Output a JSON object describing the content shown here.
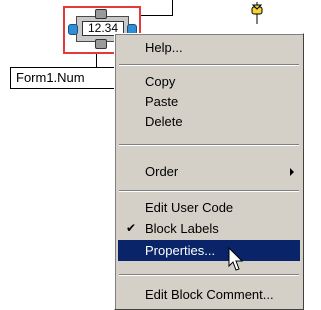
{
  "block": {
    "value": "12.34"
  },
  "form_label": "Form1.Num",
  "context_menu": {
    "help": "Help...",
    "copy": "Copy",
    "paste": "Paste",
    "delete": "Delete",
    "order": "Order",
    "edit_user_code": "Edit User Code",
    "block_labels": "Block Labels",
    "block_labels_checked": true,
    "properties": "Properties...",
    "edit_block_comment": "Edit Block Comment..."
  },
  "colors": {
    "selection_border": "#e23b3b",
    "port_blue": "#2e8fd6",
    "menu_bg": "#d4d0c8",
    "highlight": "#0a246a",
    "yellow_icon": "#f2d33a"
  }
}
